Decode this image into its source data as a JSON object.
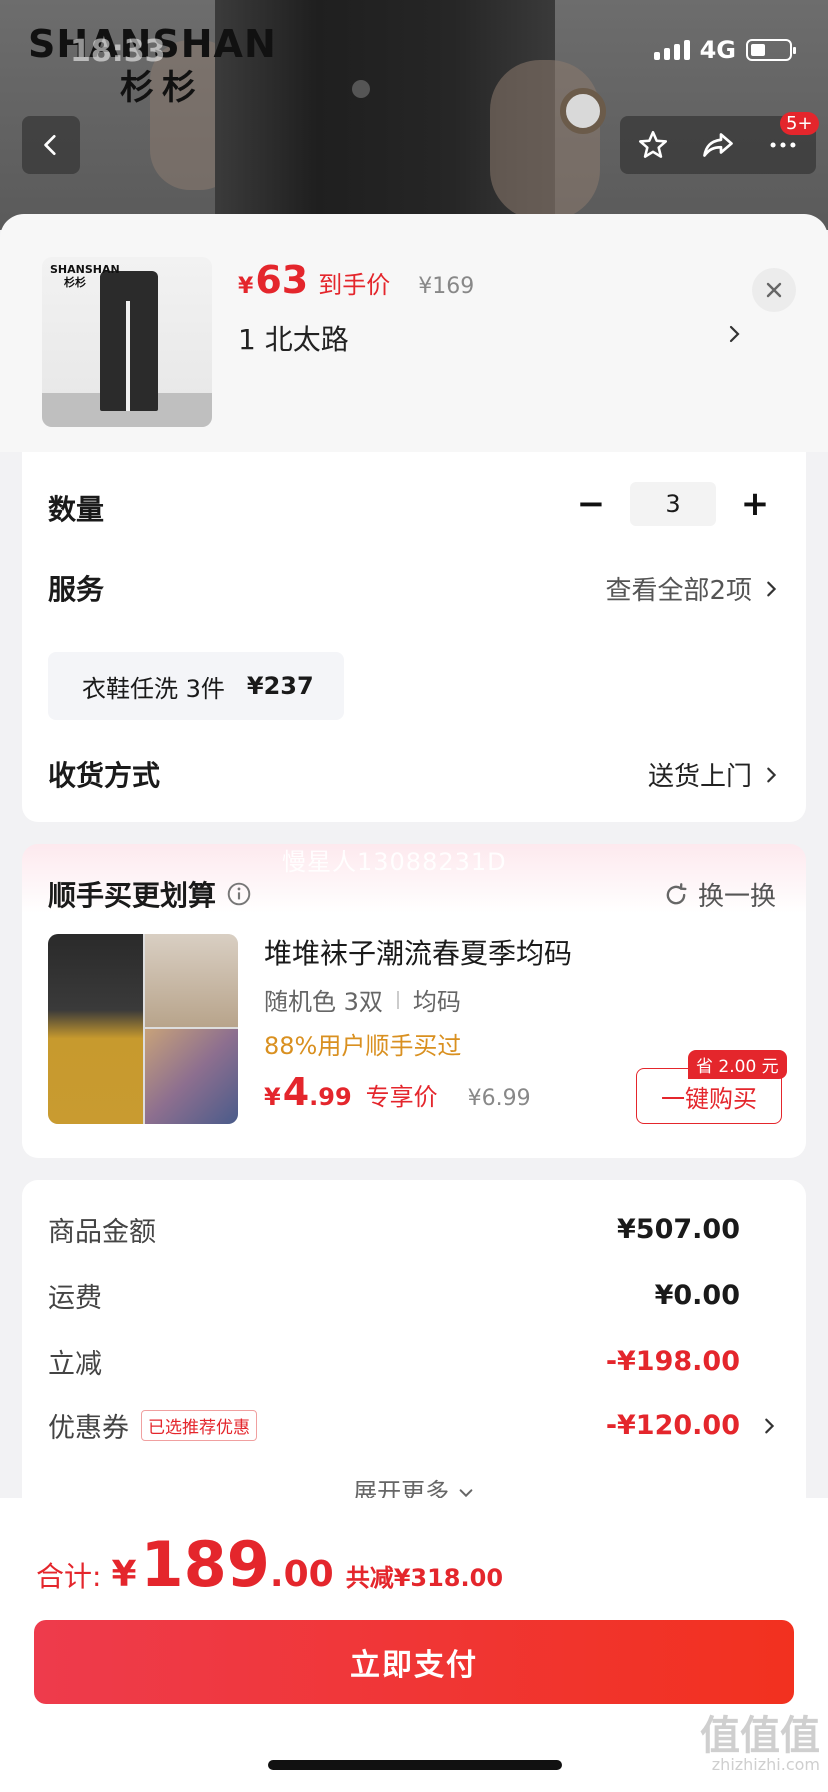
{
  "status_bar": {
    "time": "18:33",
    "network": "4G"
  },
  "brand": {
    "en": "SHANSHAN",
    "cn": "杉杉",
    "thumb_en": "SHANSHAN",
    "thumb_cn": "杉杉"
  },
  "top_actions": {
    "badge": "5+"
  },
  "product": {
    "price_symbol": "¥",
    "price": "63",
    "price_tag": "到手价",
    "original_price": "¥169",
    "address": "1  北太路"
  },
  "quantity": {
    "label": "数量",
    "value": "3",
    "minus": "−",
    "plus": "+"
  },
  "service": {
    "label": "服务",
    "view_all": "查看全部2项",
    "chip_name": "衣鞋任洗 3件",
    "chip_price": "¥237"
  },
  "delivery": {
    "label": "收货方式",
    "value": "送货上门"
  },
  "watermark": "慢星人13088231D",
  "recommend": {
    "title": "顺手买更划算",
    "swap": "换一换",
    "name": "堆堆袜子潮流春夏季均码",
    "spec_color": "随机色 3双",
    "spec_size": "均码",
    "bought_pct": "88%用户顺手买过",
    "price_symbol": "¥",
    "price_int": "4",
    "price_dec": ".99",
    "price_tag": "专享价",
    "original_price": "¥6.99",
    "save_tag": "省 2.00 元",
    "buy_label": "一键购买"
  },
  "fees": {
    "goods_label": "商品金额",
    "goods_value": "¥507.00",
    "shipping_label": "运费",
    "shipping_value": "¥0.00",
    "discount_label": "立减",
    "discount_value": "-¥198.00",
    "coupon_label": "优惠券",
    "coupon_chip": "已选推荐优惠",
    "coupon_value": "-¥120.00",
    "expand": "展开更多"
  },
  "total": {
    "label": "合计:",
    "symbol": "¥",
    "int": "189",
    "dec": ".00",
    "saved": "共减¥318.00"
  },
  "pay_button": "立即支付",
  "corner_mark": {
    "main": "值值值",
    "sub": "zhizhizhi.com"
  },
  "colors": {
    "accent": "#e4262c",
    "orange": "#d99020"
  }
}
